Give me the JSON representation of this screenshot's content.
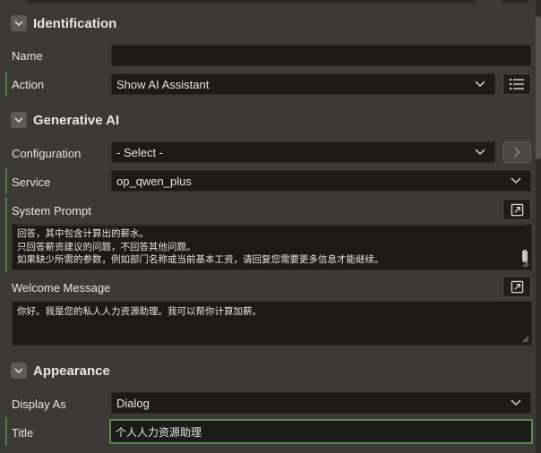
{
  "sections": {
    "identification": {
      "title": "Identification"
    },
    "generative_ai": {
      "title": "Generative AI"
    },
    "appearance": {
      "title": "Appearance"
    }
  },
  "fields": {
    "name": {
      "label": "Name",
      "value": ""
    },
    "action": {
      "label": "Action",
      "value": "Show AI Assistant"
    },
    "configuration": {
      "label": "Configuration",
      "value": "- Select -"
    },
    "service": {
      "label": "Service",
      "value": "op_qwen_plus"
    },
    "system_prompt": {
      "label": "System Prompt",
      "lines": [
        "回答，其中包含计算出的薪水。",
        "只回答薪资建议的问题，不回答其他问题。",
        "如果缺少所需的参数，例如部门名称或当前基本工资，请回复您需要更多信息才能继续。"
      ]
    },
    "welcome_message": {
      "label": "Welcome Message",
      "value": "你好。我是您的私人人力资源助理。我可以帮你计算加薪。"
    },
    "display_as": {
      "label": "Display As",
      "value": "Dialog"
    },
    "title": {
      "label": "Title",
      "value": "个人人力资源助理"
    }
  },
  "icons": {
    "collapse": "chevron-down-icon",
    "select": "chevron-down-icon",
    "list": "list-icon",
    "next": "chevron-right-icon",
    "expand": "expand-dialog-icon"
  },
  "colors": {
    "background": "#3b3a36",
    "input_bg": "#1c1b19",
    "accent_green": "#4a7a4e",
    "focus_green": "#5d8a53",
    "text": "#e8e6e1"
  }
}
